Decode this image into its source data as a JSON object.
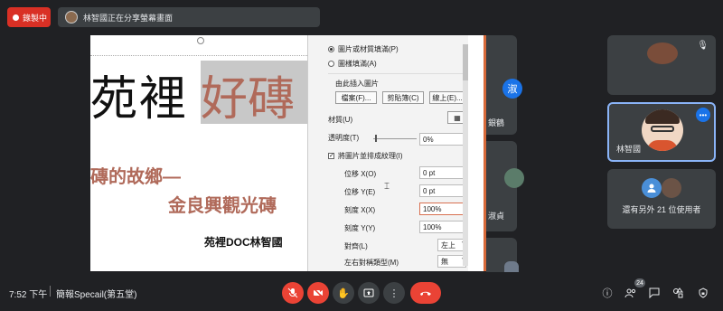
{
  "topbar": {
    "recording_label": "錄製中",
    "share_banner": "林智國正在分享螢幕畫面"
  },
  "slide": {
    "title_part1": "苑裡",
    "title_part2": "好磚",
    "line1": "磚的故鄉—",
    "line2": "金良興觀光磚",
    "author": "苑裡DOC林智國"
  },
  "format_panel": {
    "fill_picture": "圖片或材質填滿(P)",
    "fill_pattern": "圖樣填滿(A)",
    "insert_from": "由此插入圖片",
    "btn_file": "檔案(F)...",
    "btn_clipboard": "剪貼簿(C)",
    "btn_online": "線上(E)...",
    "texture_label": "材質(U)",
    "transparency_label": "透明度(T)",
    "transparency_value": "0%",
    "tile_label": "將圖片並排成紋理(I)",
    "offset_x_label": "位移 X(O)",
    "offset_x_value": "0 pt",
    "offset_y_label": "位移 Y(E)",
    "offset_y_value": "0 pt",
    "scale_x_label": "刻度 X(X)",
    "scale_x_value": "100%",
    "scale_y_label": "刻度 Y(Y)",
    "scale_y_value": "100%",
    "alignment_label": "對齊(L)",
    "alignment_value": "左上",
    "mirror_label": "左右對稱類型(M)",
    "mirror_value": "無"
  },
  "peek_tiles": {
    "tile1_initial": "淑",
    "tile1_name": "銀鶴",
    "tile2_name": "淑貞"
  },
  "participants": {
    "tile1_name": "",
    "tile2_name": "林智國",
    "others_text": "還有另外 21 位使用者"
  },
  "bottombar": {
    "time": "7:52 下午",
    "meeting_name": "簡報Specail(第五堂)",
    "participant_count": "24"
  },
  "colors": {
    "record_red": "#d93025",
    "end_call_red": "#ea4335",
    "active_border": "#8ab4f8",
    "slide_accent": "#b06a5a"
  }
}
